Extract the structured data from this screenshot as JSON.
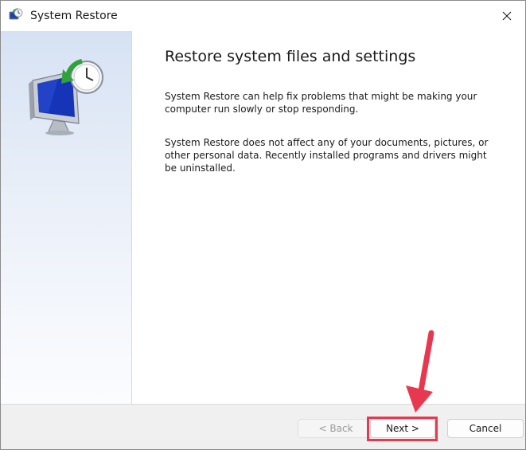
{
  "window": {
    "title": "System Restore"
  },
  "content": {
    "heading": "Restore system files and settings",
    "paragraph_1": "System Restore can help fix problems that might be making your computer run slowly or stop responding.",
    "paragraph_2": "System Restore does not affect any of your documents, pictures, or other personal data. Recently installed programs and drivers might be uninstalled."
  },
  "buttons": {
    "back_label": "< Back",
    "next_label": "Next >",
    "cancel_label": "Cancel",
    "back_enabled": false
  },
  "icons": {
    "title_icon": "system-restore-icon",
    "illustration": "system-restore-illustration",
    "close": "close-icon",
    "annotation": "red-arrow-annotation"
  },
  "colors": {
    "annotation": "#e8384f",
    "side_panel_top": "#d6e2f4",
    "side_panel_bottom": "#fbfcfe"
  }
}
